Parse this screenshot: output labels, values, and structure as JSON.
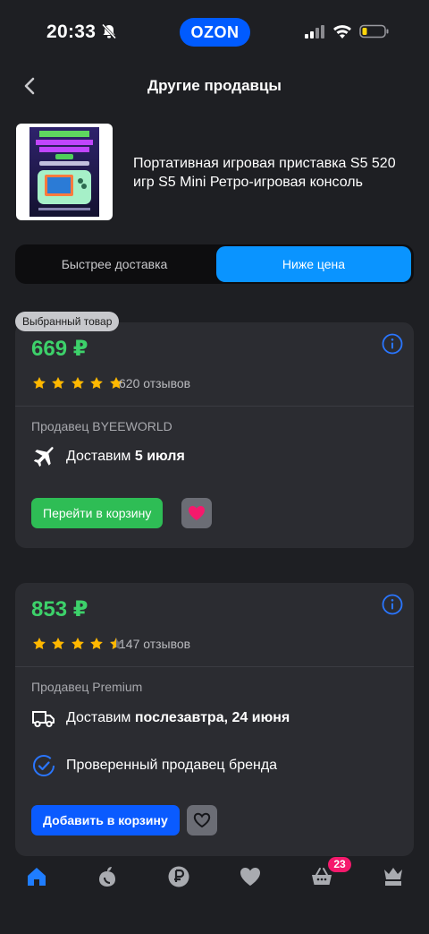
{
  "status_bar": {
    "time": "20:33",
    "brand": "OZON"
  },
  "header": {
    "title": "Другие продавцы"
  },
  "product": {
    "title": "Портативная игровая приставка S5 520 игр S5 Mini Ретро-игровая консоль"
  },
  "sort_toggle": {
    "options": [
      "Быстрее доставка",
      "Ниже цена"
    ],
    "selected": "Ниже цена"
  },
  "offers": [
    {
      "badge": "Выбранный товар",
      "price": "669 ₽",
      "rating": 5,
      "reviews": "620 отзывов",
      "seller": "Продавец BYEEWORLD",
      "delivery_prefix": "Доставим ",
      "delivery_date": "5 июля",
      "delivery_icon": "airplane-icon",
      "button_label": "Перейти в корзину",
      "favorited": true
    },
    {
      "price": "853 ₽",
      "rating": 4.5,
      "reviews": "147 отзывов",
      "seller": "Продавец Premium",
      "delivery_prefix": "Доставим ",
      "delivery_date": "послезавтра, 24 июня",
      "delivery_icon": "truck-icon",
      "verified_text": "Проверенный продавец бренда",
      "button_label": "Добавить в корзину",
      "favorited": false
    }
  ],
  "tabbar": {
    "items": [
      "home-icon",
      "fresh-icon",
      "ruble-icon",
      "favorites-icon",
      "cart-icon",
      "profile-icon"
    ],
    "cart_count": "23"
  },
  "colors": {
    "accent_blue": "#0a94ff",
    "price_green": "#3dd16a",
    "button_blue": "#0a5bff",
    "badge_pink": "#f5196c"
  }
}
